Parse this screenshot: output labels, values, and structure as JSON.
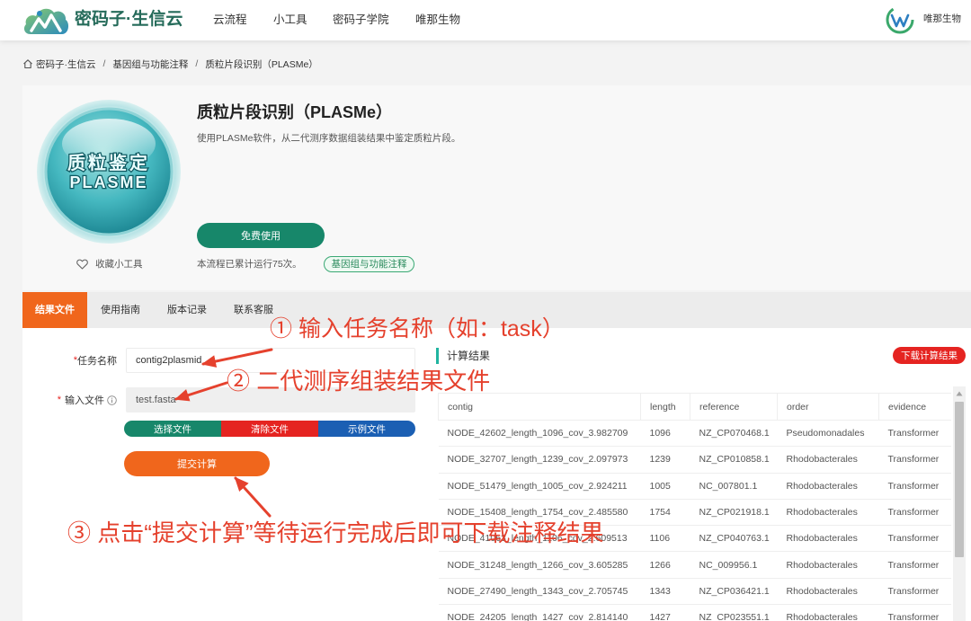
{
  "header": {
    "logo_icon": "cloud-mountain-logo-icon",
    "logo_text": "密码子·生信云",
    "nav": [
      {
        "label": "云流程"
      },
      {
        "label": "小工具"
      },
      {
        "label": "密码子学院"
      },
      {
        "label": "唯那生物"
      }
    ],
    "account_logo_icon": "weina-logo-icon",
    "account_name": "唯那生物"
  },
  "breadcrumb": {
    "home_icon": "home-icon",
    "separator": "/",
    "items": [
      "密码子·生信云",
      "基因组与功能注释",
      "质粒片段识别（PLASMe）"
    ]
  },
  "tool": {
    "image_line1": "质粒鉴定",
    "image_line2": "PLASME",
    "favorite_icon": "heart-outline-icon",
    "favorite": "收藏小工具",
    "title": "质粒片段识别（PLASMe）",
    "description": "使用PLASMe软件，从二代测序数据组装结果中鉴定质粒片段。",
    "use_button": "免费使用",
    "run_count": "本流程已累计运行75次。",
    "tag": "基因组与功能注释"
  },
  "tabs": {
    "active": 0,
    "items": [
      "结果文件",
      "使用指南",
      "版本记录",
      "联系客服"
    ]
  },
  "form": {
    "required_mark": "*",
    "task_name": {
      "label": "任务名称",
      "value": "contig2plasmid"
    },
    "input_file": {
      "label": "输入文件",
      "value": "test.fasta",
      "info_icon": "info-circle-icon"
    },
    "file_buttons": {
      "choose": "选择文件",
      "clear": "清除文件",
      "example": "示例文件"
    },
    "submit": "提交计算"
  },
  "results": {
    "title": "计算结果",
    "download": "下载计算结果",
    "columns": [
      "contig",
      "length",
      "reference",
      "order",
      "evidence"
    ],
    "rows": [
      [
        "NODE_42602_length_1096_cov_3.982709",
        "1096",
        "NZ_CP070468.1",
        "Pseudomonadales",
        "Transformer"
      ],
      [
        "NODE_32707_length_1239_cov_2.097973",
        "1239",
        "NZ_CP010858.1",
        "Rhodobacterales",
        "Transformer"
      ],
      [
        "NODE_51479_length_1005_cov_2.924211",
        "1005",
        "NC_007801.1",
        "Rhodobacterales",
        "Transformer"
      ],
      [
        "NODE_15408_length_1754_cov_2.485580",
        "1754",
        "NZ_CP021918.1",
        "Rhodobacterales",
        "Transformer"
      ],
      [
        "NODE_41063_length_1106_cov_2.609513",
        "1106",
        "NZ_CP040763.1",
        "Rhodobacterales",
        "Transformer"
      ],
      [
        "NODE_31248_length_1266_cov_3.605285",
        "1266",
        "NC_009956.1",
        "Rhodobacterales",
        "Transformer"
      ],
      [
        "NODE_27490_length_1343_cov_2.705745",
        "1343",
        "NZ_CP036421.1",
        "Rhodobacterales",
        "Transformer"
      ],
      [
        "NODE_24205_length_1427_cov_2.814140",
        "1427",
        "NZ_CP023551.1",
        "Rhodobacterales",
        "Transformer"
      ]
    ]
  },
  "annotations": {
    "step1": "① 输入任务名称（如：task）",
    "step2": "② 二代测序组装结果文件",
    "step3": "③ 点击“提交计算”等待运行完成后即可下载注释结果"
  },
  "colors": {
    "brand_green": "#17876a",
    "orange": "#f0661c",
    "danger_red": "#e52421",
    "blue": "#1b5fb3",
    "teal_marker": "#20b4a0",
    "annotation_red": "#e5412d"
  }
}
